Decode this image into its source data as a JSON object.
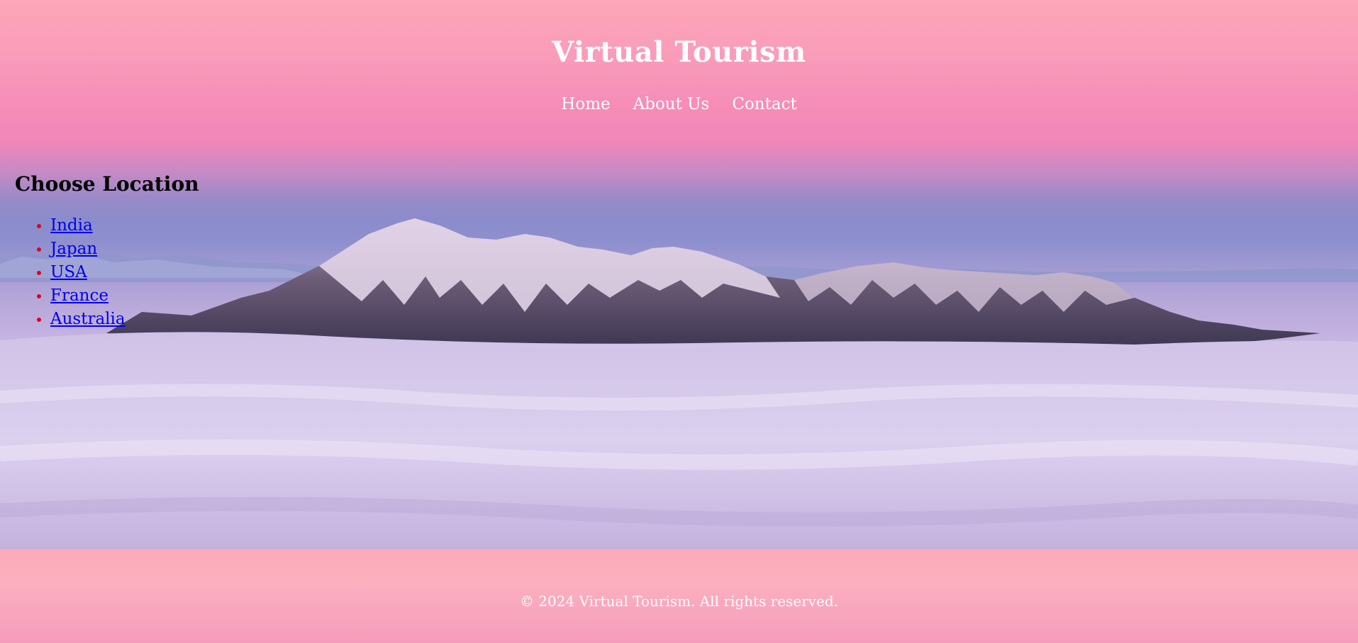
{
  "header": {
    "title": "Virtual Tourism",
    "nav": [
      {
        "label": "Home"
      },
      {
        "label": "About Us"
      },
      {
        "label": "Contact"
      }
    ]
  },
  "locations": {
    "heading": "Choose Location",
    "items": [
      {
        "label": "India"
      },
      {
        "label": "Japan"
      },
      {
        "label": "USA"
      },
      {
        "label": "France"
      },
      {
        "label": "Australia"
      }
    ]
  },
  "footer": {
    "copyright": "© 2024 Virtual Tourism. All rights reserved."
  },
  "colors": {
    "link": "#0000ee",
    "bullet": "#e0001a",
    "header_text": "#ffffff"
  }
}
